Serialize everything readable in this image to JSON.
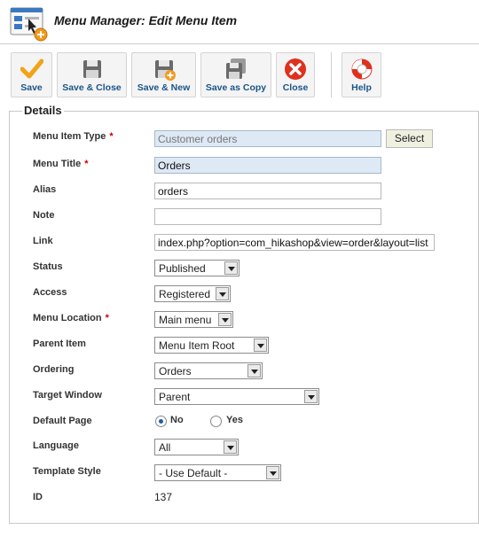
{
  "header": {
    "title": "Menu Manager: Edit Menu Item",
    "icon": "menu-manager-icon"
  },
  "toolbar": {
    "buttons": [
      {
        "label": "Save",
        "icon": "checkmark-icon"
      },
      {
        "label": "Save & Close",
        "icon": "floppy-disk-icon"
      },
      {
        "label": "Save & New",
        "icon": "floppy-disk-plus-icon"
      },
      {
        "label": "Save as Copy",
        "icon": "floppy-disk-copy-icon"
      },
      {
        "label": "Close",
        "icon": "close-circle-icon"
      },
      {
        "label": "Help",
        "icon": "lifebuoy-icon"
      }
    ]
  },
  "details": {
    "legend": "Details",
    "required_marker": "*",
    "fields": {
      "menu_item_type": {
        "label": "Menu Item Type",
        "value": "Customer orders",
        "button": "Select"
      },
      "menu_title": {
        "label": "Menu Title",
        "value": "Orders"
      },
      "alias": {
        "label": "Alias",
        "value": "orders"
      },
      "note": {
        "label": "Note",
        "value": ""
      },
      "link": {
        "label": "Link",
        "value": "index.php?option=com_hikashop&view=order&layout=list"
      },
      "status": {
        "label": "Status",
        "value": "Published"
      },
      "access": {
        "label": "Access",
        "value": "Registered"
      },
      "menu_location": {
        "label": "Menu Location",
        "value": "Main menu"
      },
      "parent_item": {
        "label": "Parent Item",
        "value": "Menu Item Root"
      },
      "ordering": {
        "label": "Ordering",
        "value": "Orders"
      },
      "target_window": {
        "label": "Target Window",
        "value": "Parent"
      },
      "default_page": {
        "label": "Default Page",
        "options": [
          "No",
          "Yes"
        ],
        "selected": "No"
      },
      "language": {
        "label": "Language",
        "value": "All"
      },
      "template_style": {
        "label": "Template Style",
        "value": "- Use Default -"
      },
      "id": {
        "label": "ID",
        "value": "137"
      }
    }
  }
}
